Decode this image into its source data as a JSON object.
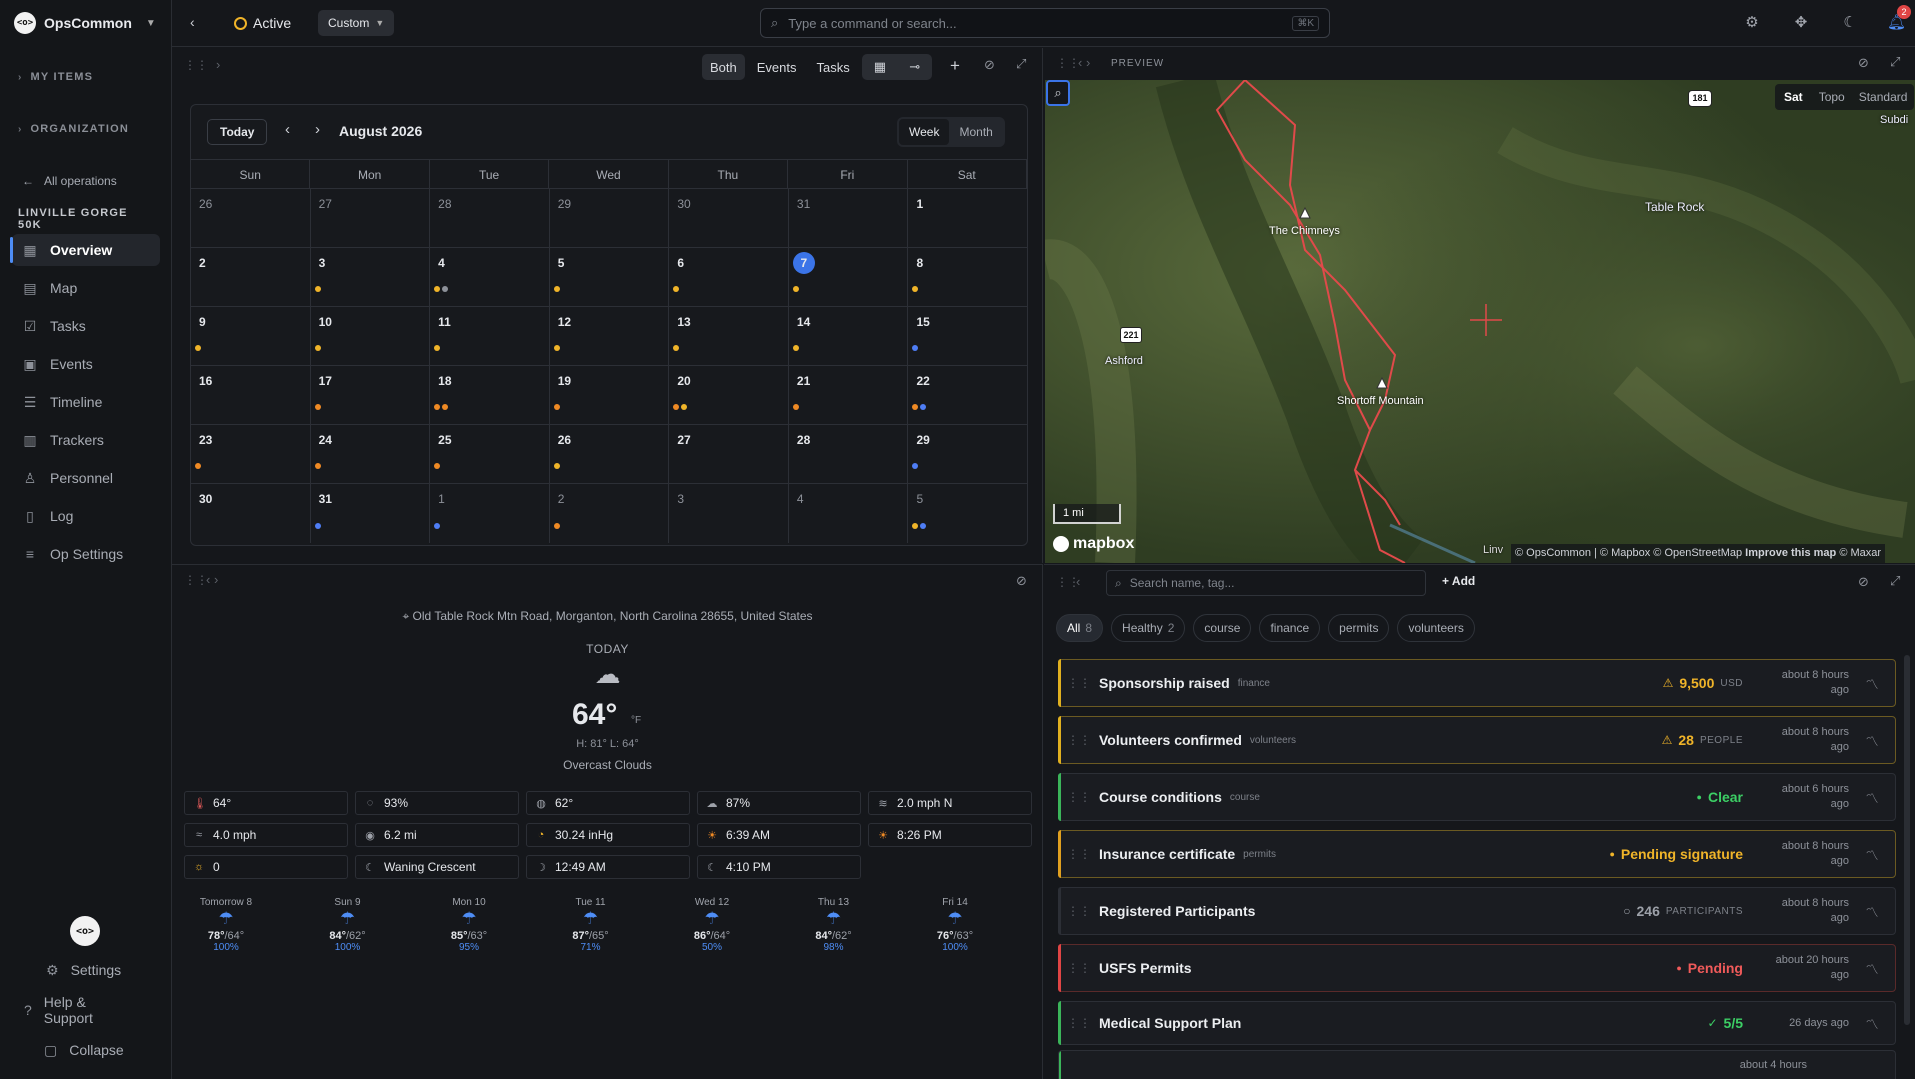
{
  "app": {
    "name": "OpsCommon",
    "logo": "<o>"
  },
  "sidebar": {
    "sections": [
      {
        "label": "MY ITEMS"
      },
      {
        "label": "ORGANIZATION"
      }
    ],
    "back": "All operations",
    "op_title": "LINVILLE GORGE 50K",
    "items": [
      {
        "label": "Overview",
        "icon": "grid-icon"
      },
      {
        "label": "Map",
        "icon": "map-icon"
      },
      {
        "label": "Tasks",
        "icon": "check-icon"
      },
      {
        "label": "Events",
        "icon": "calendar-icon"
      },
      {
        "label": "Timeline",
        "icon": "timeline-icon"
      },
      {
        "label": "Trackers",
        "icon": "chart-icon"
      },
      {
        "label": "Personnel",
        "icon": "person-icon"
      },
      {
        "label": "Log",
        "icon": "book-icon"
      },
      {
        "label": "Op Settings",
        "icon": "sliders-icon"
      }
    ],
    "bottom": {
      "settings": "Settings",
      "help": "Help & Support",
      "collapse": "Collapse"
    }
  },
  "header": {
    "status": "Active",
    "layout": "Custom",
    "search_placeholder": "Type a command or search...",
    "shortcut": "⌘K",
    "notifications": "2"
  },
  "calendar": {
    "toolbar": {
      "both": "Both",
      "events": "Events",
      "tasks": "Tasks"
    },
    "today": "Today",
    "month_title": "August 2026",
    "week": "Week",
    "month": "Month",
    "dow": [
      "Sun",
      "Mon",
      "Tue",
      "Wed",
      "Thu",
      "Fri",
      "Sat"
    ],
    "weeks": [
      [
        {
          "n": "26",
          "m": 1
        },
        {
          "n": "27",
          "m": 1
        },
        {
          "n": "28",
          "m": 1
        },
        {
          "n": "29",
          "m": 1
        },
        {
          "n": "30",
          "m": 1
        },
        {
          "n": "31",
          "m": 1
        },
        {
          "n": "1",
          "m": 0
        }
      ],
      [
        {
          "n": "2"
        },
        {
          "n": "3",
          "d": [
            "y"
          ]
        },
        {
          "n": "4",
          "d": [
            "y",
            "g"
          ]
        },
        {
          "n": "5",
          "d": [
            "y"
          ]
        },
        {
          "n": "6",
          "d": [
            "y"
          ]
        },
        {
          "n": "7",
          "d": [
            "y"
          ],
          "today": 1
        },
        {
          "n": "8",
          "d": [
            "y"
          ]
        }
      ],
      [
        {
          "n": "9",
          "d": [
            "y"
          ]
        },
        {
          "n": "10",
          "d": [
            "y"
          ]
        },
        {
          "n": "11",
          "d": [
            "y"
          ]
        },
        {
          "n": "12",
          "d": [
            "y"
          ]
        },
        {
          "n": "13",
          "d": [
            "y"
          ]
        },
        {
          "n": "14",
          "d": [
            "y"
          ]
        },
        {
          "n": "15",
          "d": [
            "b"
          ]
        }
      ],
      [
        {
          "n": "16"
        },
        {
          "n": "17",
          "d": [
            "o"
          ]
        },
        {
          "n": "18",
          "d": [
            "o",
            "o"
          ]
        },
        {
          "n": "19",
          "d": [
            "o"
          ]
        },
        {
          "n": "20",
          "d": [
            "o",
            "y"
          ]
        },
        {
          "n": "21",
          "d": [
            "o"
          ]
        },
        {
          "n": "22",
          "d": [
            "o",
            "b"
          ]
        }
      ],
      [
        {
          "n": "23",
          "d": [
            "o"
          ]
        },
        {
          "n": "24",
          "d": [
            "o"
          ]
        },
        {
          "n": "25",
          "d": [
            "o"
          ]
        },
        {
          "n": "26",
          "d": [
            "y"
          ]
        },
        {
          "n": "27"
        },
        {
          "n": "28"
        },
        {
          "n": "29",
          "d": [
            "b"
          ]
        }
      ],
      [
        {
          "n": "30"
        },
        {
          "n": "31",
          "d": [
            "b"
          ]
        },
        {
          "n": "1",
          "m": 1,
          "d": [
            "b"
          ]
        },
        {
          "n": "2",
          "m": 1,
          "d": [
            "o"
          ]
        },
        {
          "n": "3",
          "m": 1
        },
        {
          "n": "4",
          "m": 1
        },
        {
          "n": "5",
          "m": 1,
          "d": [
            "y",
            "b"
          ]
        }
      ]
    ]
  },
  "dot_colors": {
    "y": "#f0b429",
    "o": "#f08a24",
    "g": "#8d9199",
    "b": "#4e7df5"
  },
  "weather": {
    "address": "Old Table Rock Mtn Road, Morganton, North Carolina 28655, United States",
    "today": "TODAY",
    "temp": "64°",
    "unit": "°F",
    "hilo": "H: 81° L: 64°",
    "desc": "Overcast Clouds",
    "cells": [
      {
        "v": "64°",
        "i": "thermometer-icon"
      },
      {
        "v": "93%",
        "i": "humidity-icon"
      },
      {
        "v": "62°",
        "i": "dewpoint-icon"
      },
      {
        "v": "87%",
        "i": "cloud-icon"
      },
      {
        "v": "2.0 mph N",
        "i": "wind-icon"
      },
      {
        "v": "4.0 mph",
        "i": "gust-icon"
      },
      {
        "v": "6.2 mi",
        "i": "visibility-icon"
      },
      {
        "v": "30.24 inHg",
        "i": "pressure-icon"
      },
      {
        "v": "6:39 AM",
        "i": "sunrise-icon"
      },
      {
        "v": "8:26 PM",
        "i": "sunset-icon"
      },
      {
        "v": "0",
        "i": "uv-icon"
      },
      {
        "v": "Waning Crescent",
        "i": "moon-icon"
      },
      {
        "v": "12:49 AM",
        "i": "moonrise-icon"
      },
      {
        "v": "4:10 PM",
        "i": "moonset-icon"
      }
    ],
    "forecast": [
      {
        "d": "Tomorrow 8",
        "hi": "78°",
        "lo": "/64°",
        "p": "100%"
      },
      {
        "d": "Sun 9",
        "hi": "84°",
        "lo": "/62°",
        "p": "100%"
      },
      {
        "d": "Mon 10",
        "hi": "85°",
        "lo": "/63°",
        "p": "95%"
      },
      {
        "d": "Tue 11",
        "hi": "87°",
        "lo": "/65°",
        "p": "71%"
      },
      {
        "d": "Wed 12",
        "hi": "86°",
        "lo": "/64°",
        "p": "50%"
      },
      {
        "d": "Thu 13",
        "hi": "84°",
        "lo": "/62°",
        "p": "98%"
      },
      {
        "d": "Fri 14",
        "hi": "76°",
        "lo": "/63°",
        "p": "100%"
      }
    ]
  },
  "map": {
    "title": "PREVIEW",
    "styles": [
      "Sat",
      "Topo",
      "Standard"
    ],
    "labels": {
      "chimneys": "The Chimneys",
      "shortoff": "Shortoff Mountain",
      "tablerock": "Table Rock",
      "ashford": "Ashford",
      "subdiv": "Subdi",
      "linv": "Linv"
    },
    "shields": {
      "r221": "221",
      "r181": "181"
    },
    "scale": "1 mi",
    "mapbox": "mapbox",
    "attribution": "© OpsCommon | © Mapbox © OpenStreetMap",
    "improve": "Improve this map",
    "maxar": "© Maxar"
  },
  "trackers": {
    "search_placeholder": "Search name, tag...",
    "add": "Add",
    "filters": [
      {
        "l": "All",
        "c": "8"
      },
      {
        "l": "Healthy",
        "c": "2"
      },
      {
        "l": "course"
      },
      {
        "l": "finance"
      },
      {
        "l": "permits"
      },
      {
        "l": "volunteers"
      }
    ],
    "rows": [
      {
        "name": "Sponsorship raised",
        "tag": "finance",
        "val": "9,500",
        "unit": "USD",
        "ago1": "about 8 hours",
        "ago2": "ago",
        "color": "#e0b020",
        "vc": "#f0b429",
        "icon": "warning-icon"
      },
      {
        "name": "Volunteers confirmed",
        "tag": "volunteers",
        "val": "28",
        "unit": "PEOPLE",
        "ago1": "about 8 hours",
        "ago2": "ago",
        "color": "#e0b020",
        "vc": "#f0b429",
        "icon": "warning-icon"
      },
      {
        "name": "Course conditions",
        "tag": "course",
        "val": "Clear",
        "unit": "",
        "ago1": "about 6 hours",
        "ago2": "ago",
        "color": "#3bb55a",
        "vc": "#3ccf65",
        "icon": "dot-icon"
      },
      {
        "name": "Insurance certificate",
        "tag": "permits",
        "val": "Pending signature",
        "unit": "",
        "ago1": "about 8 hours",
        "ago2": "ago",
        "color": "#e0a020",
        "vc": "#f0b429",
        "icon": "dot-icon"
      },
      {
        "name": "Registered Participants",
        "tag": "",
        "val": "246",
        "unit": "PARTICIPANTS",
        "ago1": "about 8 hours",
        "ago2": "ago",
        "color": "#2c2f36",
        "vc": "#9da1a9",
        "icon": "circle-icon"
      },
      {
        "name": "USFS Permits",
        "tag": "",
        "val": "Pending",
        "unit": "",
        "ago1": "about 20 hours",
        "ago2": "ago",
        "color": "#e04545",
        "vc": "#f05a5a",
        "icon": "dot-icon"
      },
      {
        "name": "Medical Support Plan",
        "tag": "",
        "val": "5/5",
        "unit": "",
        "ago1": "26 days ago",
        "ago2": "",
        "color": "#3bb55a",
        "vc": "#3ccf65",
        "icon": "check-circle-icon"
      }
    ],
    "partial_ago": "about 4 hours"
  }
}
